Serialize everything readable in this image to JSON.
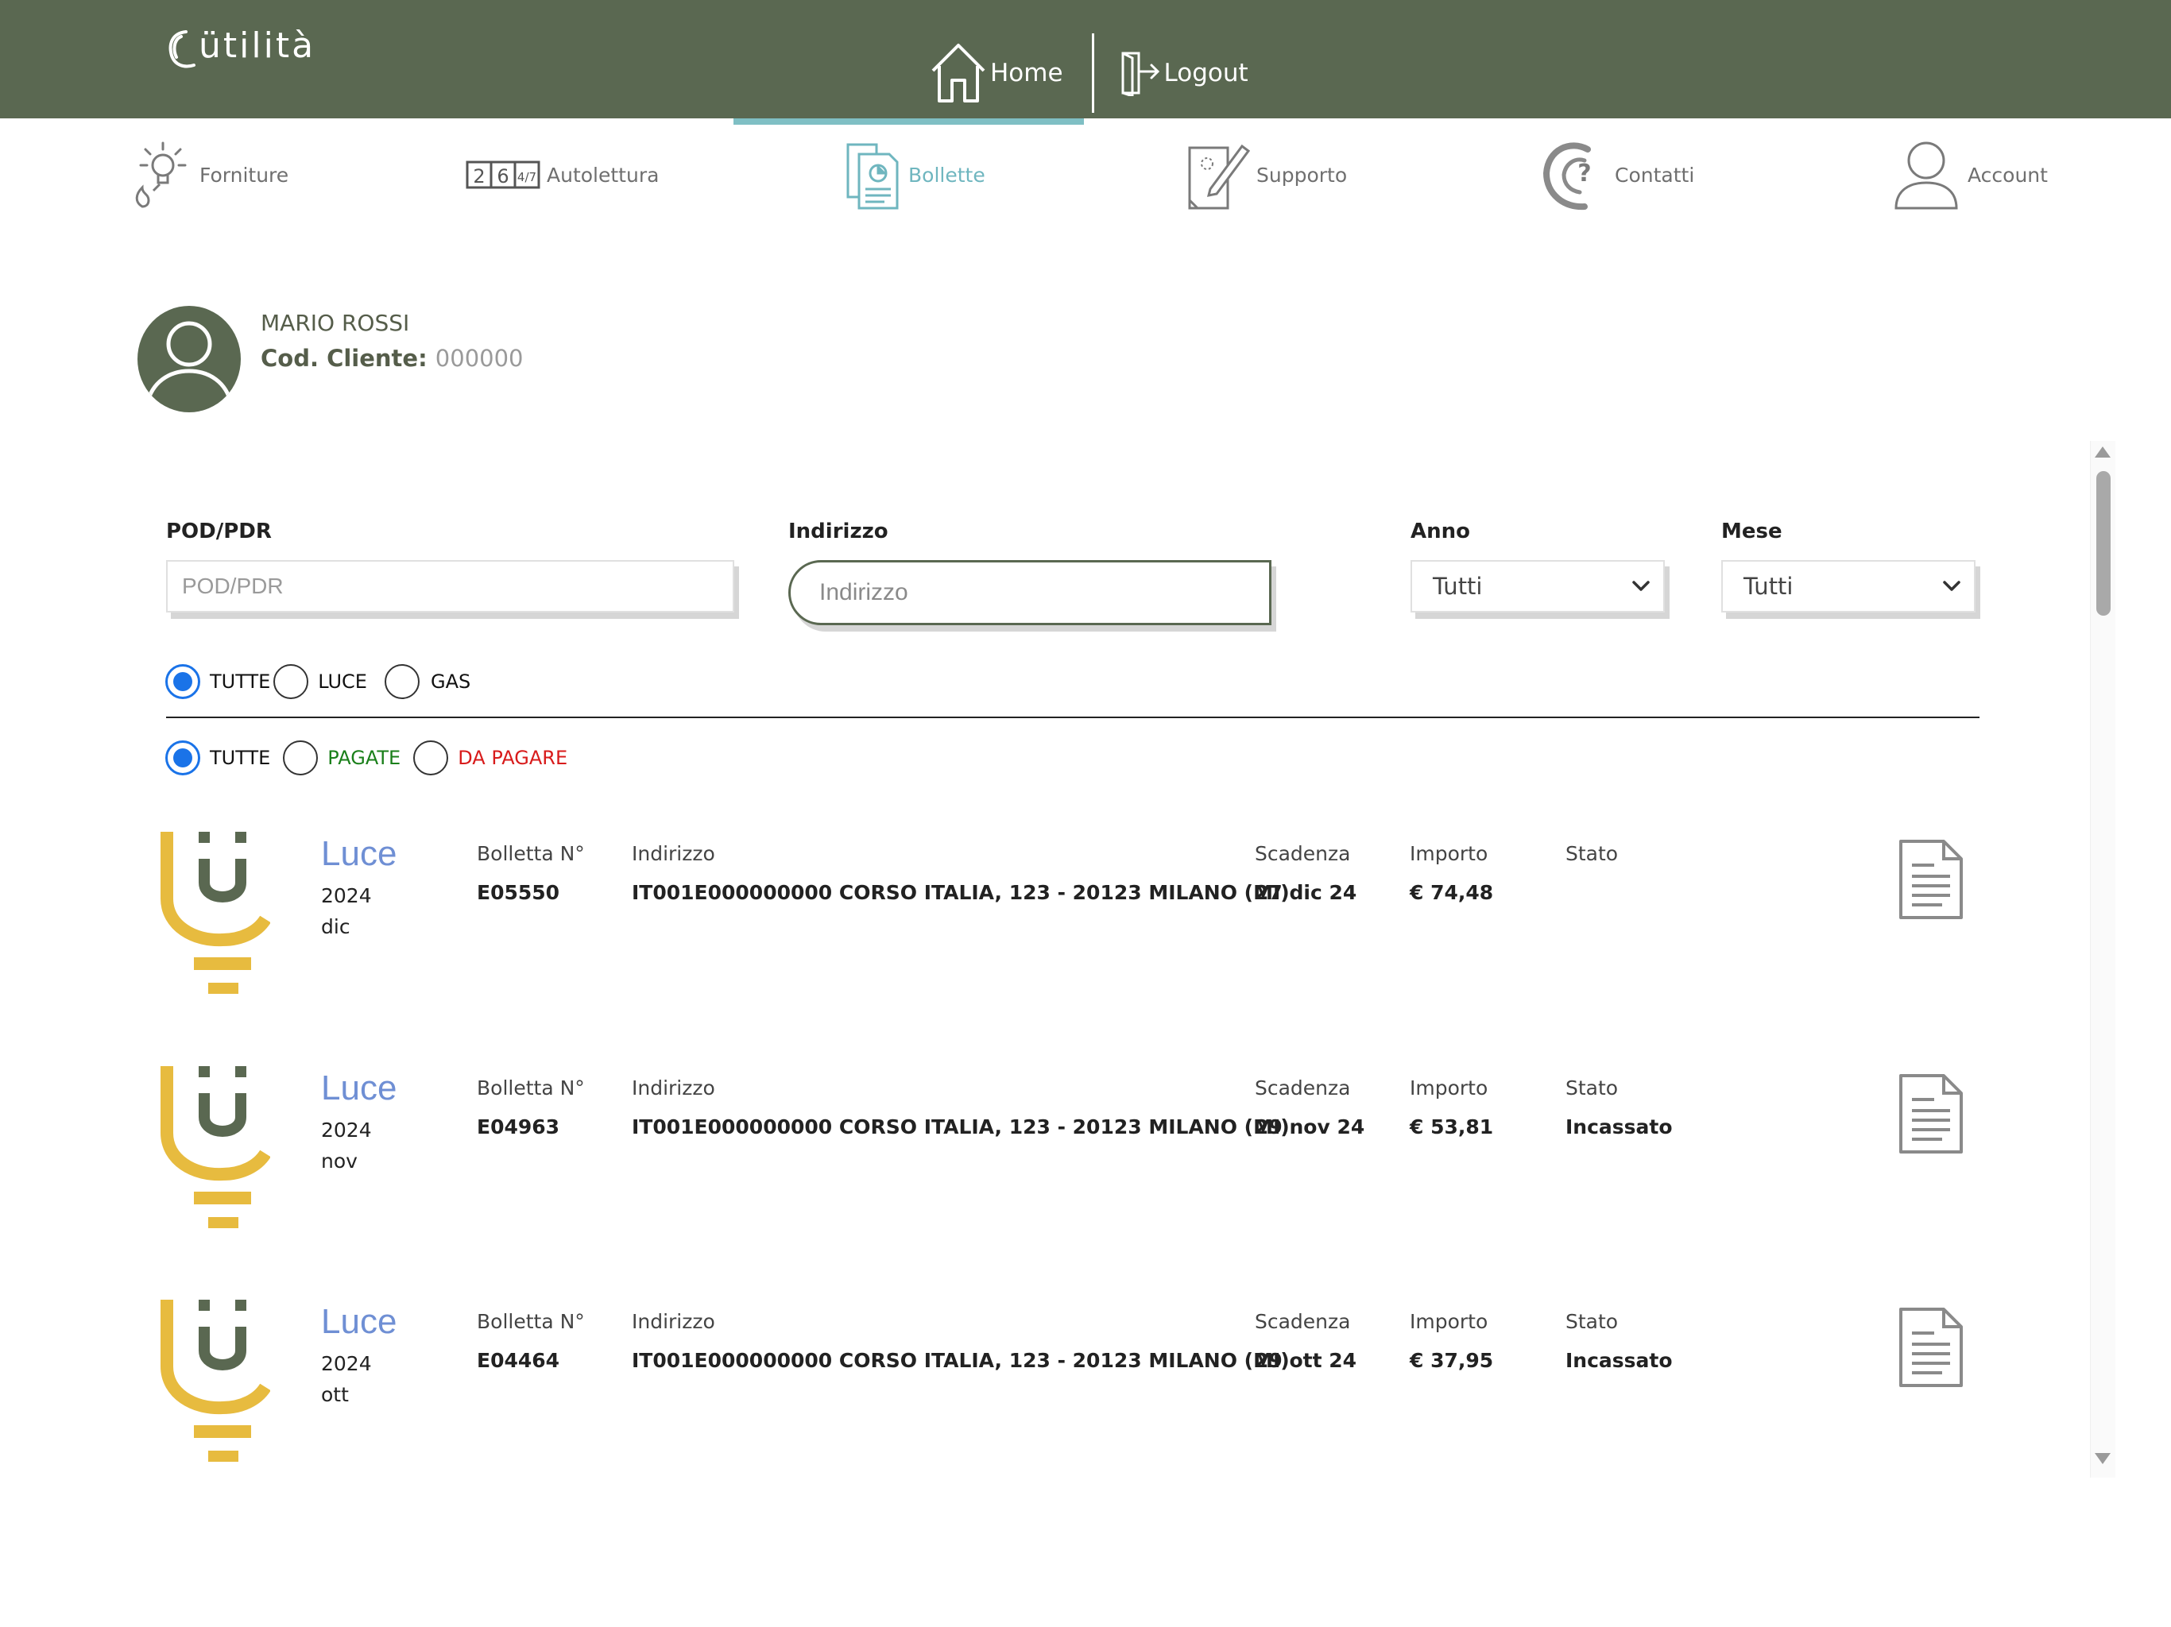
{
  "brand": {
    "logo_text": "ütilità"
  },
  "top_nav": {
    "home": "Home",
    "logout": "Logout"
  },
  "sub_nav": [
    "Forniture",
    "Autolettura",
    "Bollette",
    "Supporto",
    "Contatti",
    "Account"
  ],
  "sub_nav_active": "Bollette",
  "autolettura_digits": [
    "2",
    "6",
    "4/7"
  ],
  "user": {
    "name": "MARIO ROSSI",
    "code_label": "Cod. Cliente:",
    "code_value": "000000"
  },
  "filters": {
    "pod_label": "POD/PDR",
    "pod_placeholder": "POD/PDR",
    "indirizzo_label": "Indirizzo",
    "indirizzo_placeholder": "Indirizzo",
    "anno_label": "Anno",
    "anno_value": "Tutti",
    "mese_label": "Mese",
    "mese_value": "Tutti"
  },
  "supply_filter": {
    "options": [
      "TUTTE",
      "LUCE",
      "GAS"
    ],
    "selected": "TUTTE"
  },
  "payment_filter": {
    "options": [
      "TUTTE",
      "PAGATE",
      "DA PAGARE"
    ],
    "selected": "TUTTE",
    "colors": {
      "PAGATE": "#1a7f1a",
      "DA PAGARE": "#d81b1b"
    }
  },
  "columns": {
    "number": "Bolletta N°",
    "address": "Indirizzo",
    "due": "Scadenza",
    "amount": "Importo",
    "status": "Stato"
  },
  "bills": [
    {
      "type": "Luce",
      "year": "2024",
      "month": "dic",
      "number": "E05550",
      "address": "IT001E000000000 CORSO ITALIA, 123 - 20123 MILANO (MI)",
      "due": "27 dic 24",
      "amount": "€ 74,48",
      "status": ""
    },
    {
      "type": "Luce",
      "year": "2024",
      "month": "nov",
      "number": "E04963",
      "address": "IT001E000000000 CORSO ITALIA, 123 - 20123 MILANO (MI)",
      "due": "29 nov 24",
      "amount": "€ 53,81",
      "status": "Incassato"
    },
    {
      "type": "Luce",
      "year": "2024",
      "month": "ott",
      "number": "E04464",
      "address": "IT001E000000000 CORSO ITALIA, 123 - 20123 MILANO (MI)",
      "due": "29 ott 24",
      "amount": "€ 37,95",
      "status": "Incassato"
    }
  ],
  "colors": {
    "header_bg": "#5a6851",
    "active_tab": "#6fb6bf",
    "luce_title": "#6f8fd4",
    "logo_yellow": "#e7bb3f",
    "logo_green": "#5a6851",
    "radio_checked": "#1a73e8"
  }
}
